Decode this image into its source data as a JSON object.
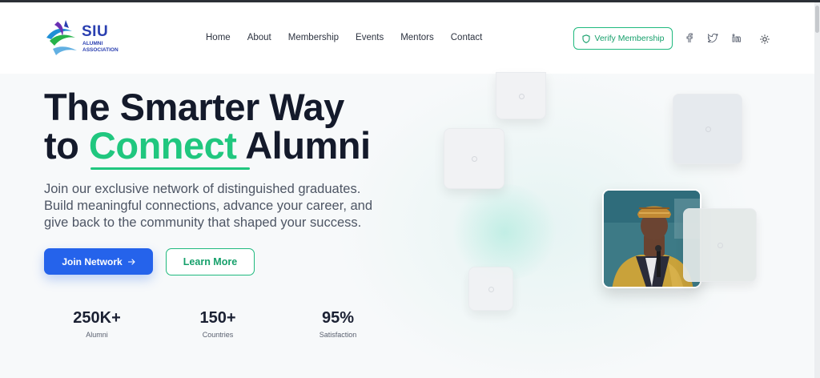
{
  "header": {
    "logo": {
      "brand": "SIU",
      "sub_line1": "ALUMNI",
      "sub_line2": "ASSOCIATION"
    },
    "nav": [
      "Home",
      "About",
      "Membership",
      "Events",
      "Mentors",
      "Contact"
    ],
    "verify_label": "Verify Membership",
    "social_icons": [
      "facebook-icon",
      "twitter-icon",
      "linkedin-icon",
      "theme-toggle-icon"
    ]
  },
  "hero": {
    "title_line1": "The Smarter Way",
    "title_line2_prefix": "to ",
    "title_line2_accent": "Connect",
    "title_line2_suffix": " Alumni",
    "description": "Join our exclusive network of distinguished graduates. Build meaningful connections, advance your career, and give back to the community that shaped your success.",
    "join_label": "Join Network",
    "learn_label": "Learn More"
  },
  "stats": [
    {
      "value": "250K+",
      "label": "Alumni"
    },
    {
      "value": "150+",
      "label": "Countries"
    },
    {
      "value": "95%",
      "label": "Satisfaction"
    }
  ],
  "colors": {
    "accent_green": "#20c77f",
    "primary_blue": "#2563eb",
    "heading": "#141a2b"
  }
}
